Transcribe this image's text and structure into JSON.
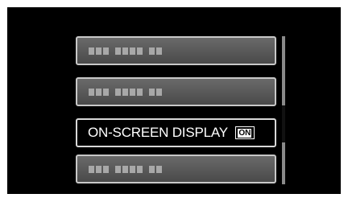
{
  "menu": {
    "items": [
      {
        "type": "placeholder"
      },
      {
        "type": "placeholder"
      },
      {
        "type": "selected",
        "label": "ON-SCREEN DISPLAY",
        "badge": "ON"
      },
      {
        "type": "placeholder"
      }
    ],
    "scroll_position": 0.62
  },
  "colors": {
    "background": "#000000",
    "item_fill": "#5a5a5a",
    "item_border": "#c8c8c8",
    "text": "#ffffff"
  }
}
